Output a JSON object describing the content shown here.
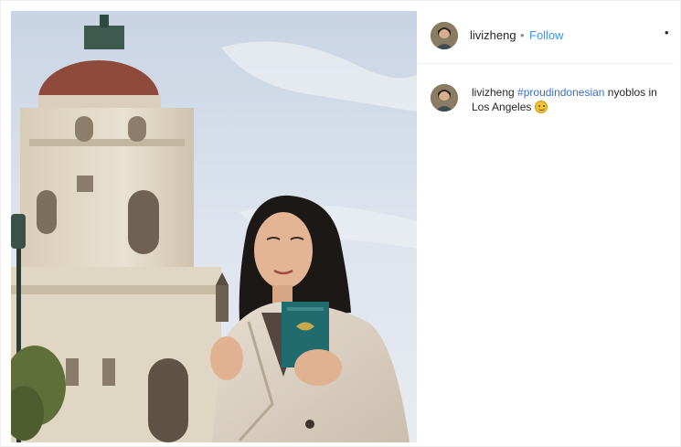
{
  "post": {
    "image_alt": "Woman holding a green passport in front of a domed city hall building",
    "header": {
      "username": "livizheng",
      "separator": "•",
      "follow_label": "Follow",
      "more_icon": "more-options-icon",
      "more_glyph": "•"
    },
    "caption": {
      "username": "livizheng",
      "hashtag": "#proudindonesian",
      "text": " nyoblos in Los Angeles ",
      "emoji_icon": "grinning-face-icon"
    }
  },
  "colors": {
    "link_blue": "#3897f0",
    "hashtag_blue": "#3a6ec0",
    "text": "#262626",
    "divider": "#efefef"
  }
}
